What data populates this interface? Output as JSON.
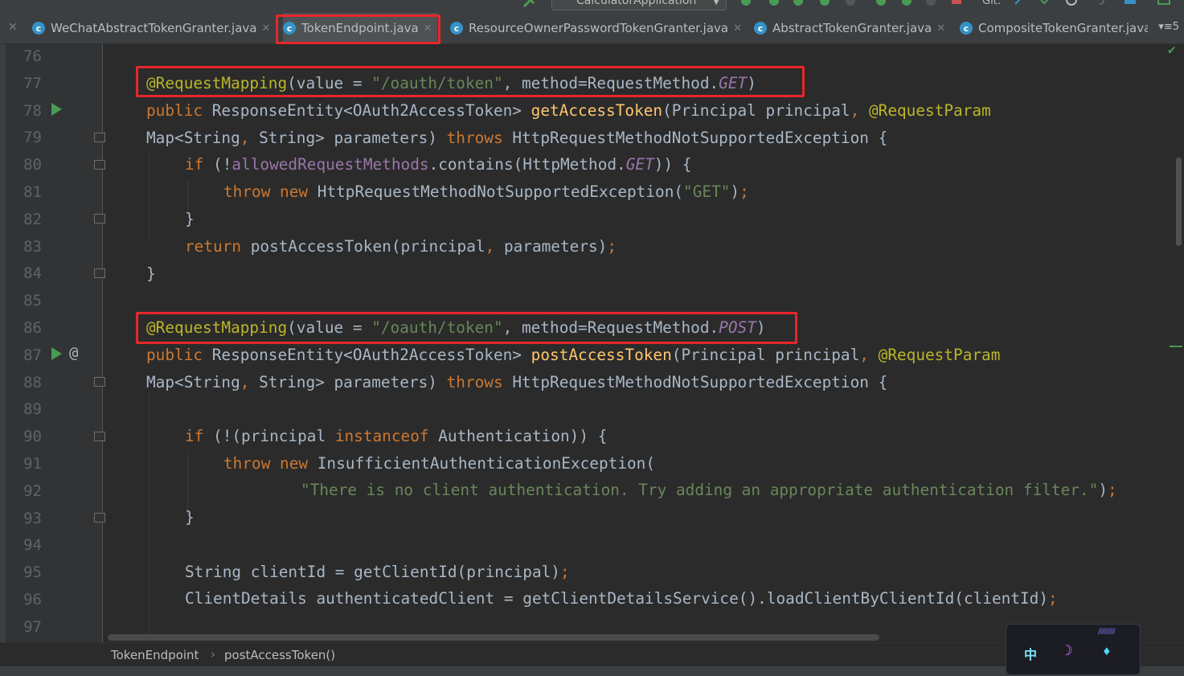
{
  "toolbar": {
    "run_config": "CalculatorApplication",
    "git_label": "Git:"
  },
  "tabs": [
    {
      "label": "WeChatAbstractTokenGranter.java",
      "active": false
    },
    {
      "label": "TokenEndpoint.java",
      "active": true
    },
    {
      "label": "ResourceOwnerPasswordTokenGranter.java",
      "active": false
    },
    {
      "label": "AbstractTokenGranter.java",
      "active": false
    },
    {
      "label": "CompositeTokenGranter.java",
      "active": false
    }
  ],
  "tab_overflow_count": "5",
  "line_numbers": [
    "76",
    "77",
    "78",
    "79",
    "80",
    "81",
    "82",
    "83",
    "84",
    "85",
    "86",
    "87",
    "88",
    "89",
    "90",
    "91",
    "92",
    "93",
    "94",
    "95",
    "96",
    "97"
  ],
  "code": {
    "l77": {
      "ann": "@RequestMapping",
      "p1": "(value = ",
      "str": "\"/oauth/token\"",
      "p2": ", method=RequestMethod.",
      "const": "GET",
      "p3": ")"
    },
    "l78": {
      "kw": "public",
      "t1": " ResponseEntity<OAuth2AccessToken> ",
      "fn": "getAccessToken",
      "t2": "(Principal principal",
      "comma": ",",
      "sp": " ",
      "ann": "@RequestParam"
    },
    "l79": {
      "t1": "Map<String",
      "comma": ",",
      "t2": " String> parameters) ",
      "kw": "throws",
      "t3": " HttpRequestMethodNotSupportedException {"
    },
    "l80": {
      "kw": "if",
      "t1": " (!",
      "fld": "allowedRequestMethods",
      "t2": ".contains(HttpMethod.",
      "const": "GET",
      "t3": ")) {"
    },
    "l81": {
      "kw1": "throw",
      "kw2": " new",
      "t1": " HttpRequestMethodNotSupportedException(",
      "str": "\"GET\"",
      "t2": ")",
      "semi": ";"
    },
    "l82": {
      "t1": "}"
    },
    "l83": {
      "kw": "return",
      "t1": " postAccessToken(principal",
      "comma": ",",
      "t2": " parameters)",
      "semi": ";"
    },
    "l84": {
      "t1": "}"
    },
    "l86": {
      "ann": "@RequestMapping",
      "p1": "(value = ",
      "str": "\"/oauth/token\"",
      "p2": ", method=RequestMethod.",
      "const": "POST",
      "p3": ")"
    },
    "l87": {
      "kw": "public",
      "t1": " ResponseEntity<OAuth2AccessToken> ",
      "fn": "postAccessToken",
      "t2": "(Principal principal",
      "comma": ",",
      "sp": " ",
      "ann": "@RequestParam"
    },
    "l88": {
      "t1": "Map<String",
      "comma": ",",
      "t2": " String> parameters) ",
      "kw": "throws",
      "t3": " HttpRequestMethodNotSupportedException {"
    },
    "l90": {
      "kw": "if",
      "t1": " (!(principal ",
      "kw2": "instanceof",
      "t2": " Authentication)) {"
    },
    "l91": {
      "kw1": "throw",
      "kw2": " new",
      "t1": " InsufficientAuthenticationException("
    },
    "l92": {
      "str": "\"There is no client authentication. Try adding an appropriate authentication filter.\"",
      "t1": ")",
      "semi": ";"
    },
    "l93": {
      "t1": "}"
    },
    "l95": {
      "t1": "String clientId = getClientId(principal)",
      "semi": ";"
    },
    "l96": {
      "t1": "ClientDetails authenticatedClient = getClientDetailsService().loadClientByClientId(clientId)",
      "semi": ";"
    }
  },
  "gutter": {
    "override_marker": "@"
  },
  "breadcrumb": {
    "class_name": "TokenEndpoint",
    "separator": "›",
    "method_name": "postAccessToken()"
  },
  "widget": {
    "ime_char": "中"
  },
  "colors": {
    "highlight": "#e8262a",
    "keyword": "#cc7832",
    "annotation": "#bbb529",
    "string": "#6a8759",
    "function": "#ffc66d",
    "field": "#9876aa"
  }
}
